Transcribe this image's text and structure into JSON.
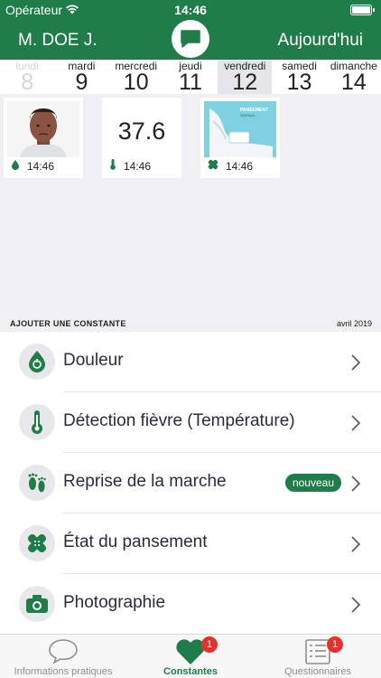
{
  "status_bar": {
    "carrier": "Opérateur",
    "time": "14:46",
    "wifi_icon": "wifi-icon",
    "battery_icon": "battery-icon"
  },
  "header": {
    "patient_name": "M. DOE J.",
    "today_label": "Aujourd'hui",
    "logo_icon": "chat-bubble-logo-icon"
  },
  "week": [
    {
      "name": "lundi",
      "date": "8"
    },
    {
      "name": "mardi",
      "date": "9"
    },
    {
      "name": "mercredi",
      "date": "10"
    },
    {
      "name": "jeudi",
      "date": "11"
    },
    {
      "name": "vendredi",
      "date": "12"
    },
    {
      "name": "samedi",
      "date": "13"
    },
    {
      "name": "dimanche",
      "date": "14"
    }
  ],
  "entries": [
    {
      "kind": "douleur",
      "time": "14:46",
      "icon": "pain-drop-icon",
      "image": "patient-face-illustration"
    },
    {
      "kind": "temperature",
      "value": "37.6",
      "time": "14:46",
      "icon": "thermometer-icon"
    },
    {
      "kind": "pansement",
      "time": "14:46",
      "icon": "bandage-icon",
      "image_caption": "PANSEMENT",
      "image_subcaption": "NORMAL"
    }
  ],
  "section": {
    "title": "AJOUTER UNE CONSTANTE",
    "period": "avril 2019"
  },
  "constants": [
    {
      "label": "Douleur",
      "icon": "pain-drop-icon"
    },
    {
      "label": "Détection fièvre (Température)",
      "icon": "thermometer-icon"
    },
    {
      "label": "Reprise de la marche",
      "icon": "footprints-icon",
      "badge": "nouveau"
    },
    {
      "label": "État du pansement",
      "icon": "bandage-icon"
    },
    {
      "label": "Photographie",
      "icon": "camera-icon"
    }
  ],
  "tabs": [
    {
      "label": "Informations pratiques",
      "icon": "speech-bubble-icon"
    },
    {
      "label": "Constantes",
      "icon": "heart-icon",
      "badge": "1"
    },
    {
      "label": "Questionnaires",
      "icon": "checklist-icon",
      "badge": "1"
    }
  ],
  "colors": {
    "brand_green": "#1e7d48",
    "badge_red": "#e0332d",
    "background": "#efeff4"
  }
}
